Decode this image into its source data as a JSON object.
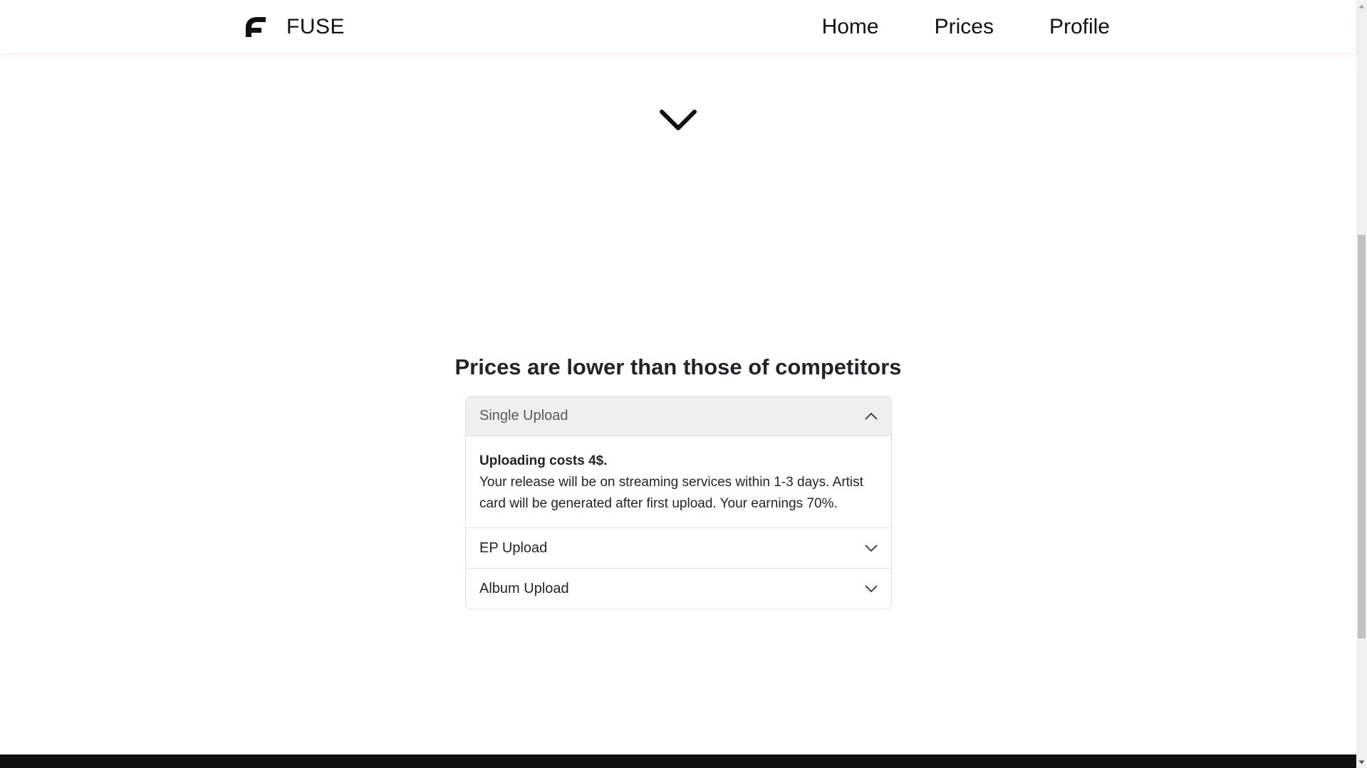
{
  "navbar": {
    "brand": "FUSE",
    "links": [
      {
        "label": "Home"
      },
      {
        "label": "Prices"
      },
      {
        "label": "Profile"
      }
    ]
  },
  "icons": {
    "brand_logo": "fuse-logo-icon",
    "scroll_down": "chevron-down-icon",
    "accordion_open": "chevron-up-icon",
    "accordion_closed": "chevron-down-icon"
  },
  "prices": {
    "title": "Prices are lower than those of competitors",
    "items": [
      {
        "label": "Single Upload",
        "expanded": true,
        "lead": "Uploading costs 4$.",
        "body": "Your release will be on streaming services within 1-3 days. Artist card will be generated after first upload. Your earnings 70%."
      },
      {
        "label": "EP Upload",
        "expanded": false
      },
      {
        "label": "Album Upload",
        "expanded": false
      }
    ]
  },
  "colors": {
    "text": "#212529",
    "accordion_active_bg": "#efefef",
    "footer": "#111111",
    "border": "#dee2e6"
  }
}
